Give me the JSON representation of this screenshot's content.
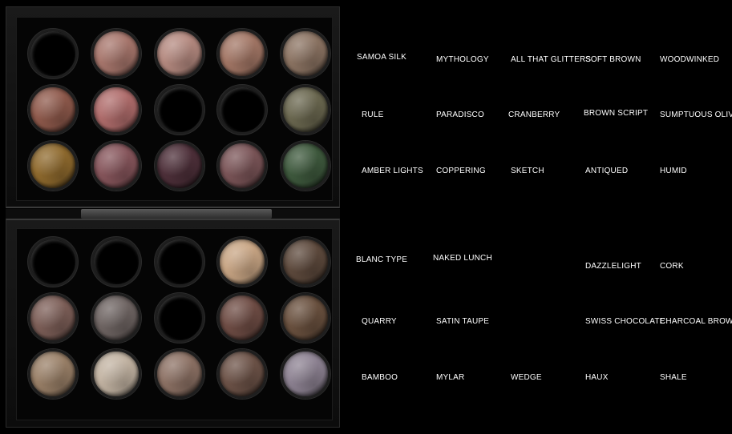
{
  "palettes": {
    "top": [
      [
        {
          "color": "",
          "filled": false
        },
        {
          "color": "#a8776d",
          "filled": true
        },
        {
          "color": "#b58a80",
          "filled": true
        },
        {
          "color": "#a37766",
          "filled": true
        },
        {
          "color": "#8c7463",
          "filled": true
        }
      ],
      [
        {
          "color": "#8f5a4c",
          "filled": true
        },
        {
          "color": "#b06d6c",
          "filled": true
        },
        {
          "color": "",
          "filled": false
        },
        {
          "color": "",
          "filled": false
        },
        {
          "color": "#6b6850",
          "filled": true
        }
      ],
      [
        {
          "color": "#8f6a2e",
          "filled": true
        },
        {
          "color": "#87565c",
          "filled": true
        },
        {
          "color": "#4e303a",
          "filled": true
        },
        {
          "color": "#7b5558",
          "filled": true
        },
        {
          "color": "#3f5a3e",
          "filled": true
        }
      ]
    ],
    "bottom": [
      [
        {
          "color": "",
          "filled": false
        },
        {
          "color": "",
          "filled": false
        },
        {
          "color": "",
          "filled": false
        },
        {
          "color": "#c8a584",
          "filled": true
        },
        {
          "color": "#5e4a3d",
          "filled": true
        }
      ],
      [
        {
          "color": "#7d5f58",
          "filled": true
        },
        {
          "color": "#6f6563",
          "filled": true
        },
        {
          "color": "",
          "filled": false
        },
        {
          "color": "#6f4d45",
          "filled": true
        },
        {
          "color": "#6a513f",
          "filled": true
        }
      ],
      [
        {
          "color": "#9a8068",
          "filled": true
        },
        {
          "color": "#c2b3a2",
          "filled": true
        },
        {
          "color": "#8d7265",
          "filled": true
        },
        {
          "color": "#6d5348",
          "filled": true
        },
        {
          "color": "#8d8292",
          "filled": true
        }
      ]
    ]
  },
  "labels": {
    "top": [
      [
        "SAMOA SILK",
        "MYTHOLOGY",
        "ALL THAT GLITTERS",
        "SOFT BROWN",
        "WOODWINKED"
      ],
      [
        "RULE",
        "PARADISCO",
        "CRANBERRY",
        "BROWN SCRIPT",
        "SUMPTUOUS OLIVE"
      ],
      [
        "AMBER LIGHTS",
        "COPPERING",
        "SKETCH",
        "ANTIQUED",
        "HUMID"
      ]
    ],
    "bottom": [
      [
        "BLANC TYPE",
        "NAKED LUNCH",
        "",
        "DAZZLELIGHT",
        "CORK"
      ],
      [
        "QUARRY",
        "SATIN TAUPE",
        "",
        "SWISS CHOCOLATE",
        "CHARCOAL BROWN"
      ],
      [
        "BAMBOO",
        "MYLAR",
        "WEDGE",
        "HAUX",
        "SHALE"
      ]
    ]
  }
}
